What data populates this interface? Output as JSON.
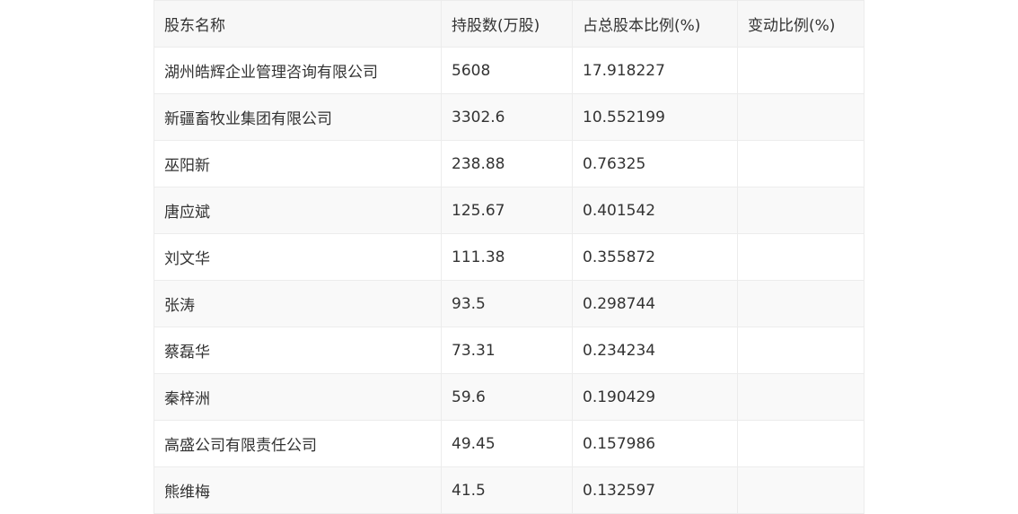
{
  "table": {
    "headers": [
      "股东名称",
      "持股数(万股)",
      "占总股本比例(%)",
      "变动比例(%)"
    ],
    "rows": [
      [
        "湖州皓辉企业管理咨询有限公司",
        "5608",
        "17.918227",
        ""
      ],
      [
        "新疆畜牧业集团有限公司",
        "3302.6",
        "10.552199",
        ""
      ],
      [
        "巫阳新",
        "238.88",
        "0.76325",
        ""
      ],
      [
        "唐应斌",
        "125.67",
        "0.401542",
        ""
      ],
      [
        "刘文华",
        "111.38",
        "0.355872",
        ""
      ],
      [
        "张涛",
        "93.5",
        "0.298744",
        ""
      ],
      [
        "蔡磊华",
        "73.31",
        "0.234234",
        ""
      ],
      [
        "秦梓洲",
        "59.6",
        "0.190429",
        ""
      ],
      [
        "高盛公司有限责任公司",
        "49.45",
        "0.157986",
        ""
      ],
      [
        "熊维梅",
        "41.5",
        "0.132597",
        ""
      ]
    ]
  }
}
